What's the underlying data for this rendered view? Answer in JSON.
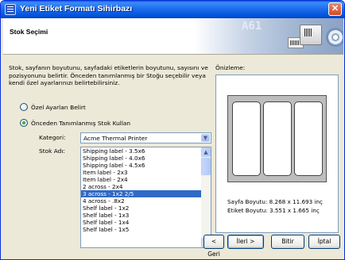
{
  "window": {
    "title": "Yeni Etiket Formatı Sihirbazı",
    "close_glyph": "✕"
  },
  "header": {
    "title": "Stok Seçimi",
    "art_text": "A61"
  },
  "description": "Stok, sayfanın boyutunu, sayfadaki etiketlerin boyutunu, sayısını ve pozisyonunu belirtir. Önceden tanımlanmış bir Stoğu seçebilir veya kendi özel ayarlarınızı belirtebilirsiniz.",
  "options": {
    "custom_label": "Özel Ayarları Belirt",
    "predefined_label": "Önceden Tanımlanmış Stok Kullan",
    "selected": "predefined"
  },
  "category": {
    "label": "Kategori:",
    "value": "Acme Thermal Printer"
  },
  "stock": {
    "label": "Stok Adı:",
    "items": [
      "Shipping label - 3.5x6",
      "Shipping label - 4.0x6",
      "Shipping label - 4.5x6",
      "Item label - 2x3",
      "Item label - 2x4",
      "2 across - 2x4",
      "3 across - 1x2 2/5",
      "4 across - .8x2",
      "Shelf label - 1x2",
      "Shelf label - 1x3",
      "Shelf label - 1x4",
      "Shelf label - 1x5"
    ],
    "selected_index": 6
  },
  "preview": {
    "label": "Önizleme:",
    "page_size": "Sayfa Boyutu: 8.268 x 11.693 inç",
    "label_size": "Etiket Boyutu: 3.551 x 1.665 inç",
    "label_columns": 3
  },
  "buttons": {
    "back": "< Geri",
    "next": "İleri >",
    "finish": "Bitir",
    "cancel": "İptal"
  },
  "icons": {
    "scroll_up": "▲",
    "scroll_down": "▼",
    "combo_arrow": "▼"
  },
  "colors": {
    "title_bar": "#0054e3",
    "selection": "#316ac5",
    "window_bg": "#ece9d8"
  }
}
